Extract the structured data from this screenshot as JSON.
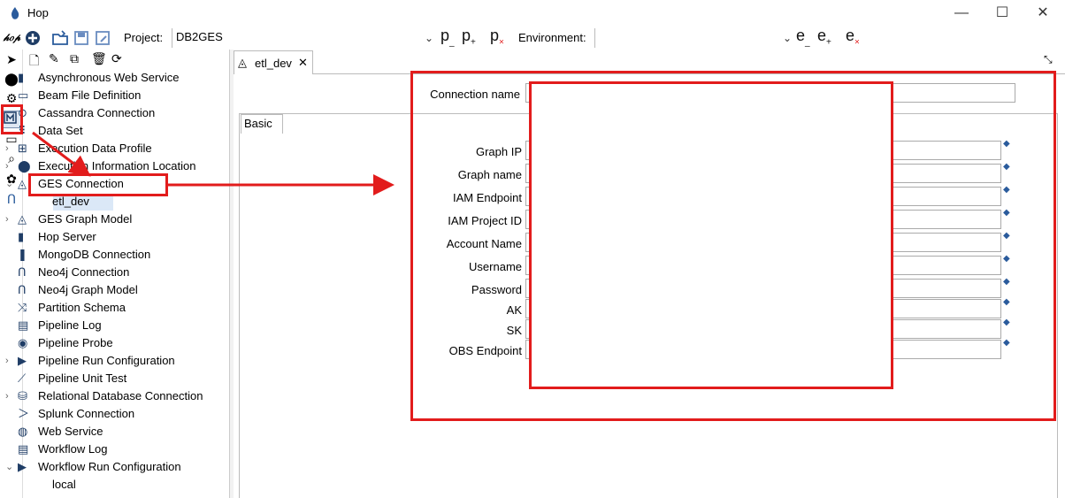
{
  "window": {
    "title": "Hop",
    "minimize": "—",
    "maximize": "☐",
    "close": "✕"
  },
  "toolbar": {
    "project_label": "Project:",
    "project_value": "DB2GES",
    "environment_label": "Environment:",
    "environment_value": "",
    "p_buttons": [
      "p",
      "p",
      "p"
    ],
    "e_buttons": [
      "e",
      "e",
      "e"
    ]
  },
  "sidebar": {
    "items": [
      {
        "label": "Asynchronous Web Service",
        "expandable": false
      },
      {
        "label": "Beam File Definition",
        "expandable": false
      },
      {
        "label": "Cassandra Connection",
        "expandable": false
      },
      {
        "label": "Data Set",
        "expandable": false
      },
      {
        "label": "Execution Data Profile",
        "expandable": true
      },
      {
        "label": "Execution Information Location",
        "expandable": true
      },
      {
        "label": "GES Connection",
        "expandable": true,
        "expanded": true,
        "children": [
          "etl_dev"
        ]
      },
      {
        "label": "GES Graph Model",
        "expandable": true
      },
      {
        "label": "Hop Server",
        "expandable": false
      },
      {
        "label": "MongoDB Connection",
        "expandable": false
      },
      {
        "label": "Neo4j Connection",
        "expandable": false
      },
      {
        "label": "Neo4j Graph Model",
        "expandable": false
      },
      {
        "label": "Partition Schema",
        "expandable": false
      },
      {
        "label": "Pipeline Log",
        "expandable": false
      },
      {
        "label": "Pipeline Probe",
        "expandable": false
      },
      {
        "label": "Pipeline Run Configuration",
        "expandable": true
      },
      {
        "label": "Pipeline Unit Test",
        "expandable": false
      },
      {
        "label": "Relational Database Connection",
        "expandable": true
      },
      {
        "label": "Splunk Connection",
        "expandable": false
      },
      {
        "label": "Web Service",
        "expandable": false
      },
      {
        "label": "Workflow Log",
        "expandable": false
      },
      {
        "label": "Workflow Run Configuration",
        "expandable": true,
        "expanded": true,
        "children": [
          "local"
        ]
      }
    ]
  },
  "editor": {
    "tab_label": "etl_dev",
    "connection_name_label": "Connection name",
    "basic_tab": "Basic",
    "fields": [
      {
        "label": "Graph IP"
      },
      {
        "label": "Graph name"
      },
      {
        "label": "IAM Endpoint"
      },
      {
        "label": "IAM Project ID"
      },
      {
        "label": "Account Name"
      },
      {
        "label": "Username"
      },
      {
        "label": "Password"
      },
      {
        "label": "AK"
      },
      {
        "label": "SK"
      },
      {
        "label": "OBS Endpoint"
      }
    ]
  },
  "colors": {
    "annotation_red": "#e21c1c",
    "selection": "#dbe8f7",
    "accent": "#2a5b9c"
  }
}
